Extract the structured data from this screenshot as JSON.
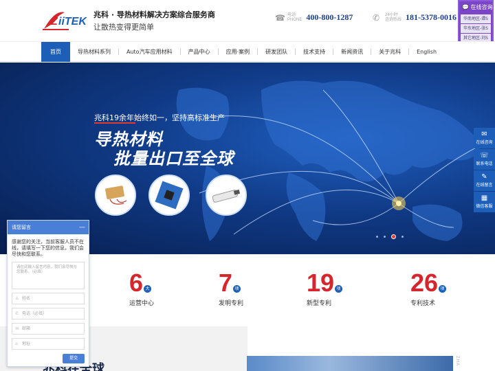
{
  "header": {
    "logo_text": "ZiiTEK",
    "brand_title": "兆科 · 导热材料解决方案综合服务商",
    "brand_sub": "让散热变得更简单",
    "phone1": {
      "caption1": "电话",
      "caption2": "PHONE",
      "number": "400-800-1287"
    },
    "phone2": {
      "caption1": "24小时",
      "caption2": "咨询热线",
      "number": "181-5378-0016"
    }
  },
  "consult": {
    "title": "在线咨询",
    "items": [
      "华南地区-谭S",
      "华东地区-张S",
      "其它地区-刘S"
    ]
  },
  "nav": {
    "items": [
      "首页",
      "导热材料系列",
      "Auto汽车应用材料",
      "产品中心",
      "应用·案例",
      "研发团队",
      "技术支持",
      "新闻资讯",
      "关于兆科",
      "English"
    ]
  },
  "banner": {
    "small_text": "兆科19余年始终如一，坚持高标准生产",
    "big_line1": "导热材料",
    "big_line2": "批量出口至全球"
  },
  "tools": [
    {
      "icon": "chat-icon",
      "label": "在线咨询"
    },
    {
      "icon": "phone-icon",
      "label": "联系电话"
    },
    {
      "icon": "message-icon",
      "label": "在线留言"
    },
    {
      "icon": "qrcode-icon",
      "label": "微信客服"
    }
  ],
  "stats": [
    {
      "num": "6",
      "unit": "大",
      "label": "运营中心"
    },
    {
      "num": "7",
      "unit": "项",
      "label": "发明专利"
    },
    {
      "num": "19",
      "unit": "项",
      "label": "新型专利"
    },
    {
      "num": "26",
      "unit": "项",
      "label": "专利技术"
    }
  ],
  "bottom": {
    "heading": "兆科在全球",
    "vertical": "ZHA"
  },
  "chat": {
    "title": "请您留言",
    "message": "感谢您的关注，当前客服人员不在线，请填写一下您的信息，我们会尽快和您联系。",
    "textarea_placeholder": "请在此输入留言内容，我们会尽快与您联系。（必填）",
    "fields": [
      "姓名",
      "电话（必填）",
      "邮箱",
      "地址"
    ],
    "submit": "提交"
  },
  "colors": {
    "brand_blue": "#1d5fb8",
    "accent_red": "#d5262d",
    "consult_purple": "#7b45c8"
  }
}
